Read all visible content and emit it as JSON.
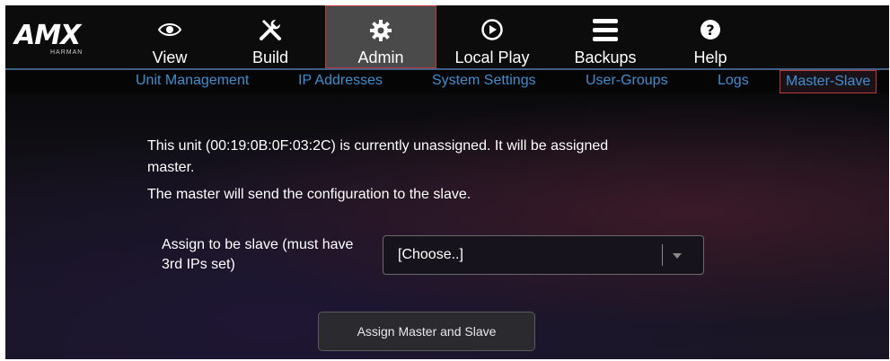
{
  "brand": {
    "name": "AMX",
    "sub": "HARMAN"
  },
  "topnav": [
    {
      "label": "View",
      "icon": "eye-icon"
    },
    {
      "label": "Build",
      "icon": "tools-icon"
    },
    {
      "label": "Admin",
      "icon": "gear-icon",
      "active": true
    },
    {
      "label": "Local Play",
      "icon": "play-circle-icon"
    },
    {
      "label": "Backups",
      "icon": "menu-lines-icon"
    },
    {
      "label": "Help",
      "icon": "question-circle-icon"
    }
  ],
  "subnav": [
    {
      "label": "Unit Management"
    },
    {
      "label": "IP Addresses"
    },
    {
      "label": "System Settings"
    },
    {
      "label": "User-Groups"
    },
    {
      "label": "Logs"
    },
    {
      "label": "Master-Slave",
      "active": true
    }
  ],
  "main": {
    "message_line1": "This unit (00:19:0B:0F:03:2C) is currently unassigned. It will be assigned",
    "message_line2": "master.",
    "message_line3": "The master will send the configuration to the slave.",
    "assign_label_line1": "Assign to be slave (must have",
    "assign_label_line2": "3rd IPs set)",
    "select_value": "[Choose..]",
    "button_label": "Assign Master and Slave"
  },
  "colors": {
    "link": "#3f8fd0",
    "active_border": "#c0393b",
    "active_bg": "#4a4a4a"
  }
}
